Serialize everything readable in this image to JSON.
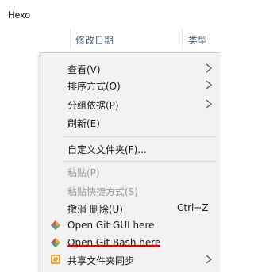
{
  "window": {
    "title": "Hexo"
  },
  "columns": {
    "date": "修改日期",
    "type": "类型"
  },
  "menu": {
    "view": "查看(V)",
    "sort": "排序方式(O)",
    "group": "分组依据(P)",
    "refresh": "刷新(E)",
    "customize": "自定义文件夹(F)...",
    "paste": "粘贴(P)",
    "paste_shortcut": "粘贴快捷方式(S)",
    "undo": "撤消 删除(U)",
    "undo_shortcut": "Ctrl+Z",
    "git_gui": "Open Git GUI here",
    "git_bash": "Open Git Bash here",
    "share": "共享文件夹同步"
  },
  "colors": {
    "menu_bg": "#f2f2f2",
    "highlight_underline": "#e00000",
    "disabled_text": "#9a9a9a",
    "column_header_text": "#4d6082"
  },
  "icons": {
    "git_gui": "git-diamond-icon",
    "git_bash": "git-diamond-icon",
    "share": "share-sync-icon",
    "submenu": "chevron-right-icon"
  }
}
